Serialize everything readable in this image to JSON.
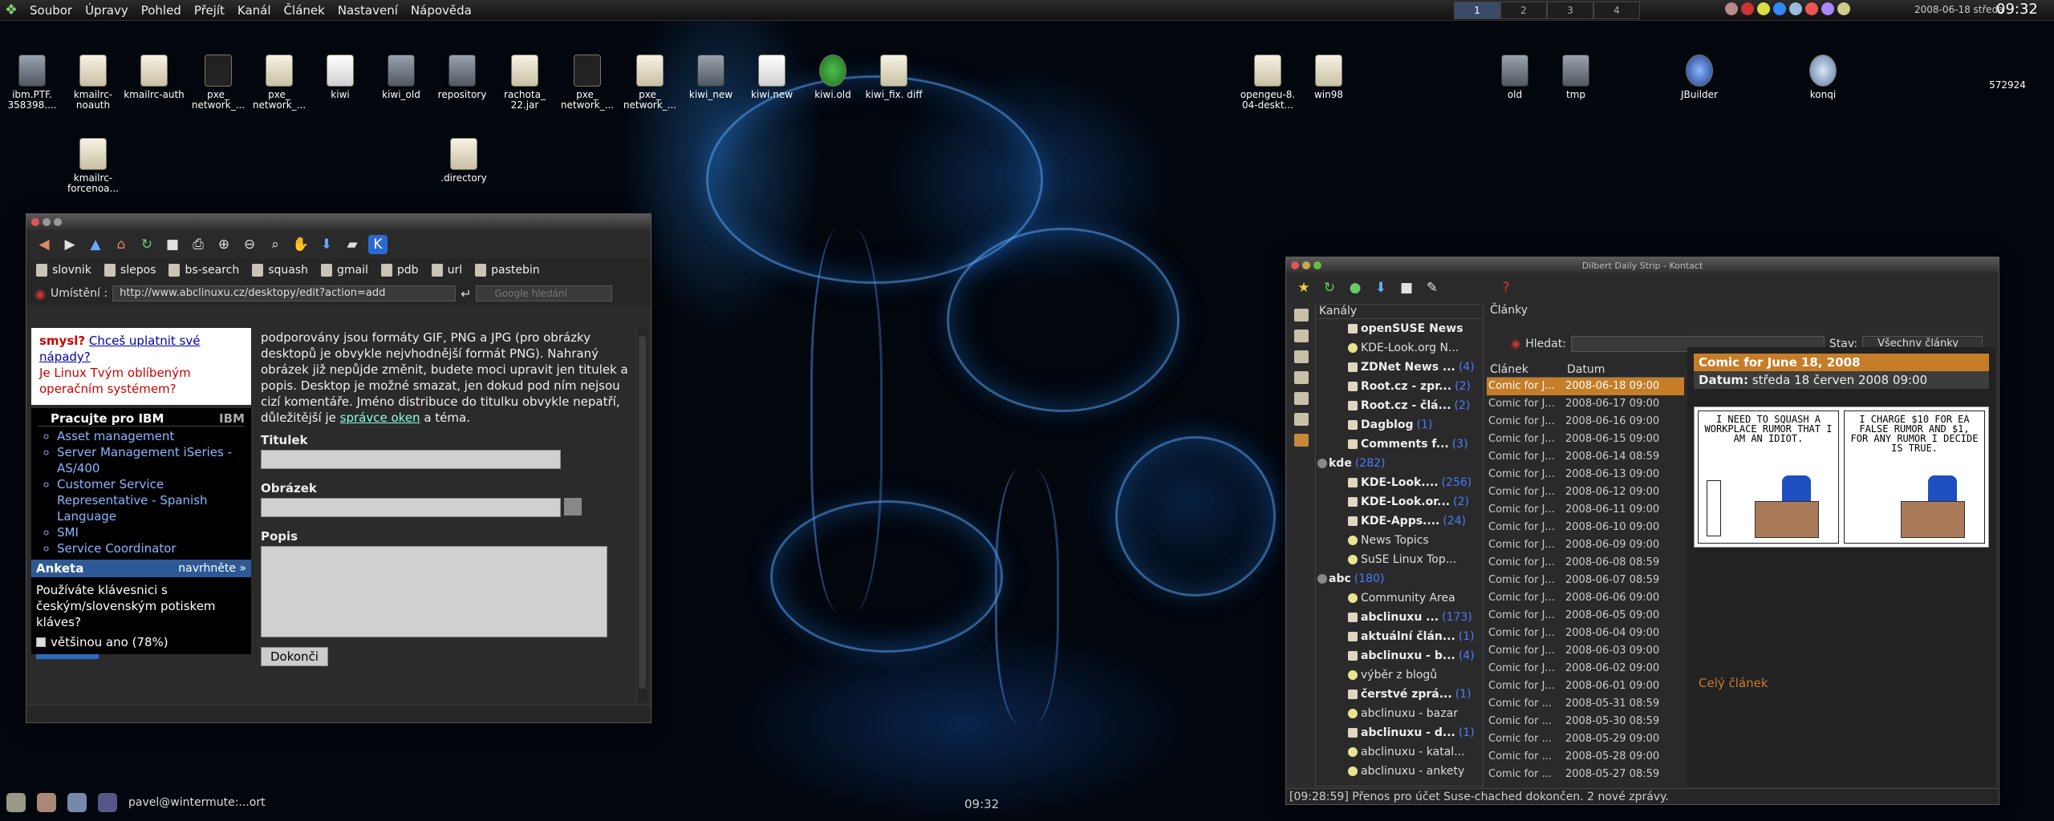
{
  "topbar": {
    "menu": [
      "Soubor",
      "Úpravy",
      "Pohled",
      "Přejít",
      "Kanál",
      "Článek",
      "Nastavení",
      "Nápověda"
    ],
    "pager": [
      "1",
      "2",
      "3",
      "4"
    ],
    "date": "2008-06-18 středa",
    "time": "09:32"
  },
  "desktop_icons": [
    {
      "label": "ibm.PTF. 358398...."
    },
    {
      "label": "kmailrc-noauth"
    },
    {
      "label": "kmailrc-auth"
    },
    {
      "label": "pxe_ network_..."
    },
    {
      "label": "pxe_ network_..."
    },
    {
      "label": "kiwi"
    },
    {
      "label": "kiwi_old"
    },
    {
      "label": "repository"
    },
    {
      "label": "rachota_ 22.jar"
    },
    {
      "label": "pxe_ network_..."
    },
    {
      "label": "pxe_ network_..."
    },
    {
      "label": "kiwi_new"
    },
    {
      "label": "kiwi.new"
    },
    {
      "label": "kiwi.old"
    },
    {
      "label": "kiwi_fix. diff"
    },
    {
      "label": "opengeu-8. 04-deskt..."
    },
    {
      "label": "win98"
    },
    {
      "label": "old"
    },
    {
      "label": "tmp"
    },
    {
      "label": "JBuilder"
    },
    {
      "label": "konqi"
    },
    {
      "label": "572924"
    },
    {
      "label": "kmailrc-forcenoa..."
    },
    {
      "label": ".directory"
    }
  ],
  "konqueror": {
    "bookmarks": [
      "slovnik",
      "slepos",
      "bs-search",
      "squash",
      "gmail",
      "pdb",
      "url",
      "pastebin"
    ],
    "location_label": "Umístění :",
    "url": "http://www.abclinuxu.cz/desktopy/edit?action=add",
    "search_placeholder": "Google hledání",
    "promo": {
      "line1": "smysl?",
      "link": "Chceš uplatnit své nápady?",
      "line2": "Je Linux Tvým oblíbeným operačním systémem?"
    },
    "ibm_box": {
      "title": "Pracujte pro IBM",
      "logo": "IBM",
      "items": [
        "Asset management",
        "Server Management iSeries - AS/400",
        "Customer Service Representative - Spanish Language",
        "SMI",
        "Service Coordinator"
      ]
    },
    "anketa": {
      "title": "Anketa",
      "suggest": "navrhněte »",
      "question": "Používáte klávesnici s českým/slovenským potiskem kláves?",
      "option": "většinou ano (78%)",
      "percent": 78
    },
    "form": {
      "intro": "podporovány jsou formáty GIF, PNG a JPG (pro obrázky desktopů je obvykle nejvhodnější formát PNG). Nahraný obrázek již nepůjde změnit, budete moci upravit jen titulek a popis. Desktop je možné smazat, jen dokud pod ním nejsou cizí komentáře. Jméno distribuce do titulku obvykle nepatří, důležitější je",
      "intro_link": "správce oken",
      "intro_end": "a téma.",
      "titulek": "Titulek",
      "obrazek": "Obrázek",
      "popis": "Popis",
      "submit": "Dokonči"
    }
  },
  "kontact": {
    "title": "Dilbert Daily Strip - Kontact",
    "feeds_header": "Kanály",
    "articles_header": "Články",
    "search_label": "Hledat:",
    "status_label": "Stav:",
    "status_value": "Všechny články",
    "col_article": "Článek",
    "col_date": "Datum",
    "feeds": [
      {
        "label": "openSUSE News",
        "count": "",
        "bold": true,
        "top": false
      },
      {
        "label": "KDE-Look.org N...",
        "count": "",
        "bold": false,
        "top": false
      },
      {
        "label": "ZDNet News ...",
        "count": "(4)",
        "bold": true,
        "top": false
      },
      {
        "label": "Root.cz - zpr...",
        "count": "(2)",
        "bold": true,
        "top": false
      },
      {
        "label": "Root.cz - člá...",
        "count": "(2)",
        "bold": true,
        "top": false
      },
      {
        "label": "Dagblog",
        "count": "(1)",
        "bold": true,
        "top": false
      },
      {
        "label": "Comments f...",
        "count": "(3)",
        "bold": true,
        "top": false
      },
      {
        "label": "kde",
        "count": "(282)",
        "bold": true,
        "top": true
      },
      {
        "label": "KDE-Look....",
        "count": "(256)",
        "bold": true,
        "top": false
      },
      {
        "label": "KDE-Look.or...",
        "count": "(2)",
        "bold": true,
        "top": false
      },
      {
        "label": "KDE-Apps....",
        "count": "(24)",
        "bold": true,
        "top": false
      },
      {
        "label": "News Topics",
        "count": "",
        "bold": false,
        "top": false
      },
      {
        "label": "SuSE Linux Top...",
        "count": "",
        "bold": false,
        "top": false
      },
      {
        "label": "abc",
        "count": "(180)",
        "bold": true,
        "top": true
      },
      {
        "label": "Community Area",
        "count": "",
        "bold": false,
        "top": false
      },
      {
        "label": "abclinuxu ...",
        "count": "(173)",
        "bold": true,
        "top": false
      },
      {
        "label": "aktuální člán...",
        "count": "(1)",
        "bold": true,
        "top": false
      },
      {
        "label": "abclinuxu - b...",
        "count": "(4)",
        "bold": true,
        "top": false
      },
      {
        "label": "výběr z blogů",
        "count": "",
        "bold": false,
        "top": false
      },
      {
        "label": "čerstvé zprá...",
        "count": "(1)",
        "bold": true,
        "top": false
      },
      {
        "label": "abclinuxu - bazar",
        "count": "",
        "bold": false,
        "top": false
      },
      {
        "label": "abclinuxu - d...",
        "count": "(1)",
        "bold": true,
        "top": false
      },
      {
        "label": "abclinuxu - katal...",
        "count": "",
        "bold": false,
        "top": false
      },
      {
        "label": "abclinuxu - ankety",
        "count": "",
        "bold": false,
        "top": false
      }
    ],
    "articles": [
      {
        "title": "Comic for J...",
        "date": "2008-06-18 09:00",
        "sel": true
      },
      {
        "title": "Comic for J...",
        "date": "2008-06-17 09:00"
      },
      {
        "title": "Comic for J...",
        "date": "2008-06-16 09:00"
      },
      {
        "title": "Comic for J...",
        "date": "2008-06-15 09:00"
      },
      {
        "title": "Comic for J...",
        "date": "2008-06-14 08:59"
      },
      {
        "title": "Comic for J...",
        "date": "2008-06-13 09:00"
      },
      {
        "title": "Comic for J...",
        "date": "2008-06-12 09:00"
      },
      {
        "title": "Comic for J...",
        "date": "2008-06-11 09:00"
      },
      {
        "title": "Comic for J...",
        "date": "2008-06-10 09:00"
      },
      {
        "title": "Comic for J...",
        "date": "2008-06-09 09:00"
      },
      {
        "title": "Comic for J...",
        "date": "2008-06-08 08:59"
      },
      {
        "title": "Comic for J...",
        "date": "2008-06-07 08:59"
      },
      {
        "title": "Comic for J...",
        "date": "2008-06-06 09:00"
      },
      {
        "title": "Comic for J...",
        "date": "2008-06-05 09:00"
      },
      {
        "title": "Comic for J...",
        "date": "2008-06-04 09:00"
      },
      {
        "title": "Comic for J...",
        "date": "2008-06-03 09:00"
      },
      {
        "title": "Comic for J...",
        "date": "2008-06-02 09:00"
      },
      {
        "title": "Comic for J...",
        "date": "2008-06-01 09:00"
      },
      {
        "title": "Comic for ...",
        "date": "2008-05-31 08:59"
      },
      {
        "title": "Comic for ...",
        "date": "2008-05-30 08:59"
      },
      {
        "title": "Comic for ...",
        "date": "2008-05-29 09:00"
      },
      {
        "title": "Comic for ...",
        "date": "2008-05-28 09:00"
      },
      {
        "title": "Comic for ...",
        "date": "2008-05-27 08:59"
      }
    ],
    "article": {
      "heading": "Comic for June 18, 2008",
      "date_label": "Datum:",
      "date_value": "středa 18 červen 2008 09:00",
      "panel1": "I NEED TO SQUASH A WORKPLACE RUMOR THAT I AM AN IDIOT.",
      "panel2": "I CHARGE $10 FOR EA FALSE RUMOR AND $1, FOR ANY RUMOR I DECIDE IS TRUE.",
      "full_link": "Celý článek"
    },
    "statusbar": "[09:28:59] Přenos pro účet Suse-chached dokončen. 2 nové zprávy."
  },
  "taskbar": {
    "task": "pavel@wintermute:...ort",
    "clock": "09:32"
  }
}
